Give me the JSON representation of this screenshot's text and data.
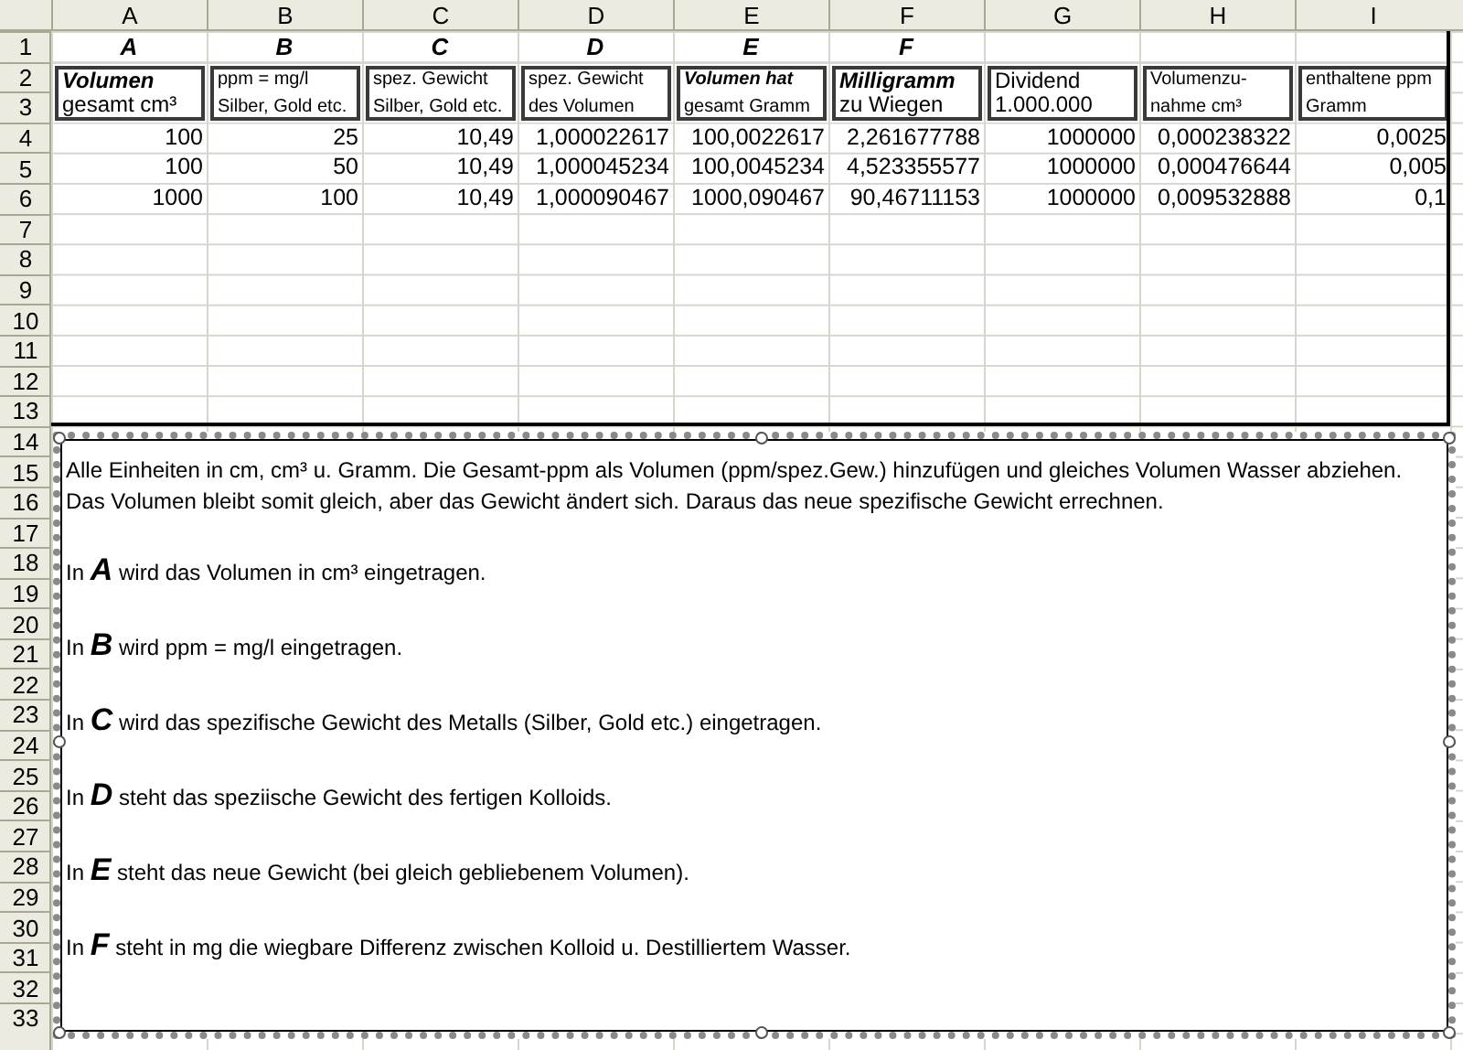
{
  "columns": [
    "A",
    "B",
    "C",
    "D",
    "E",
    "F",
    "G",
    "H",
    "I"
  ],
  "row_numbers": [
    "1",
    "2",
    "3",
    "4",
    "5",
    "6",
    "7",
    "8",
    "9",
    "10",
    "11",
    "12",
    "13",
    "14",
    "15",
    "16",
    "17",
    "18",
    "19",
    "20",
    "21",
    "22",
    "23",
    "24",
    "25",
    "26",
    "27",
    "28",
    "29",
    "30",
    "31",
    "32",
    "33"
  ],
  "column_tags": [
    "A",
    "B",
    "C",
    "D",
    "E",
    "F"
  ],
  "header_boxes": [
    {
      "lines": [
        {
          "text": "Volumen",
          "kind": "heading"
        },
        {
          "text": "gesamt cm³",
          "kind": "label"
        }
      ]
    },
    {
      "lines": [
        {
          "text": "ppm = mg/l",
          "kind": "small"
        },
        {
          "text": "Silber, Gold etc.",
          "kind": "small"
        }
      ]
    },
    {
      "lines": [
        {
          "text": "spez. Gewicht",
          "kind": "small"
        },
        {
          "text": "Silber, Gold etc.",
          "kind": "small"
        }
      ]
    },
    {
      "lines": [
        {
          "text": "spez. Gewicht",
          "kind": "small"
        },
        {
          "text": "des Volumen",
          "kind": "small"
        }
      ]
    },
    {
      "lines": [
        {
          "text": "Volumen hat",
          "kind": "small-heading"
        },
        {
          "text": "gesamt Gramm",
          "kind": "small"
        }
      ]
    },
    {
      "lines": [
        {
          "text": "Milligramm",
          "kind": "heading"
        },
        {
          "text": "zu Wiegen",
          "kind": "label"
        }
      ]
    },
    {
      "lines": [
        {
          "text": "Dividend",
          "kind": "label"
        },
        {
          "text": "1.000.000",
          "kind": "label"
        }
      ]
    },
    {
      "lines": [
        {
          "text": "Volumenzu-",
          "kind": "small"
        },
        {
          "text": "nahme cm³",
          "kind": "small"
        }
      ]
    },
    {
      "lines": [
        {
          "text": "enthaltene ppm",
          "kind": "small"
        },
        {
          "text": "Gramm",
          "kind": "small"
        }
      ]
    }
  ],
  "rows": [
    [
      "100",
      "25",
      "10,49",
      "1,000022617",
      "100,0022617",
      "2,261677788",
      "1000000",
      "0,000238322",
      "0,0025"
    ],
    [
      "100",
      "50",
      "10,49",
      "1,000045234",
      "100,0045234",
      "4,523355577",
      "1000000",
      "0,000476644",
      "0,005"
    ],
    [
      "1000",
      "100",
      "10,49",
      "1,000090467",
      "1000,090467",
      "90,46711153",
      "1000000",
      "0,009532888",
      "0,1"
    ]
  ],
  "text_box": {
    "intro": "Alle Einheiten in cm, cm³ u. Gramm. Die Gesamt-ppm als Volumen (ppm/spez.Gew.) hinzufügen und gleiches Volumen Wasser abziehen. Das Volumen bleibt somit gleich, aber das Gewicht ändert sich. Daraus das neue spezifische Gewicht errechnen.",
    "items": [
      {
        "lead": "In",
        "letter": "A",
        "rest": "wird das Volumen in cm³ eingetragen."
      },
      {
        "lead": "In",
        "letter": "B",
        "rest": "wird ppm = mg/l eingetragen."
      },
      {
        "lead": "In",
        "letter": "C",
        "rest": "wird das spezifische Gewicht des Metalls (Silber, Gold etc.) eingetragen."
      },
      {
        "lead": "In",
        "letter": "D",
        "rest": "steht das speziische Gewicht des fertigen Kolloids."
      },
      {
        "lead": "In",
        "letter": "E",
        "rest": "steht das neue Gewicht (bei gleich gebliebenem Volumen)."
      },
      {
        "lead": "In",
        "letter": "F",
        "rest": "steht in mg die wiegbare Differenz zwischen Kolloid u. Destilliertem Wasser."
      }
    ]
  }
}
